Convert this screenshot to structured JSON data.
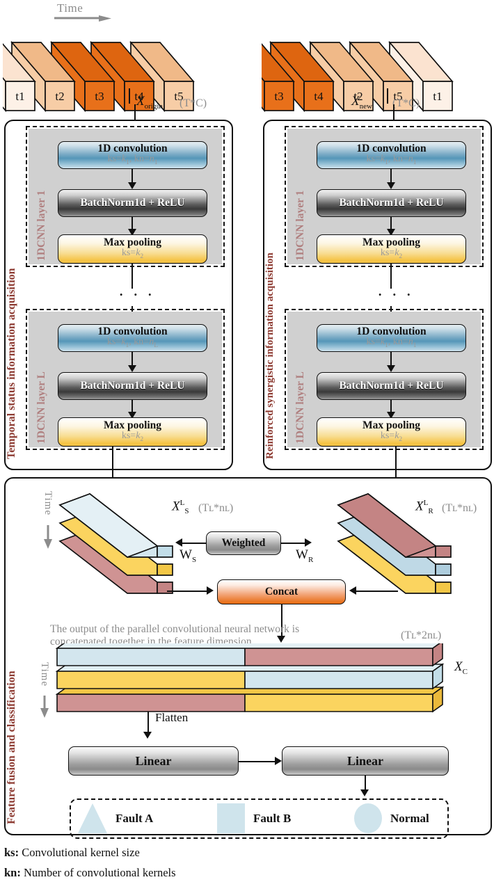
{
  "figure": {
    "time_label": "Time",
    "time_icon": "arrow-right-icon"
  },
  "input_left": {
    "steps": [
      "t1",
      "t2",
      "t3",
      "t4",
      "t5"
    ],
    "colors": [
      "#fdf1e7",
      "#f7cda6",
      "#e8701a",
      "#e8701a",
      "#f7cda6"
    ],
    "top_colors": [
      "#fbe3d0",
      "#f0b988",
      "#de6510",
      "#de6510",
      "#f0b988"
    ],
    "var_name": "X",
    "var_sub": "origin",
    "dim": "(T*C)"
  },
  "input_right": {
    "steps": [
      "t3",
      "t4",
      "t2",
      "t5",
      "t1"
    ],
    "colors": [
      "#e8701a",
      "#e8701a",
      "#f7cda6",
      "#f7cda6",
      "#fdf1e7"
    ],
    "top_colors": [
      "#de6510",
      "#de6510",
      "#f0b988",
      "#f0b988",
      "#fbe3d0"
    ],
    "var_name": "X",
    "var_sub": "new",
    "dim": "(T*C)"
  },
  "branch_left": {
    "panel_label": "Temporal status information acquisition",
    "layer1_label": "1DCNN layer 1",
    "layerL_label": "1DCNN layer L",
    "ellipsis": "· · ·"
  },
  "branch_right": {
    "panel_label": "Reinforced synergistic information acquisition",
    "layer1_label": "1DCNN layer 1",
    "layerL_label": "1DCNN layer L",
    "ellipsis": "· · ·"
  },
  "ops": {
    "conv_title": "1D convolution",
    "conv_params_layer1": "ks=k₁, kn=n₁",
    "conv_params_layerL": "ks=k₁, kn=n)",
    "bn_title": "BatchNorm1d + ReLU",
    "pool_title": "Max pooling",
    "pool_params": "ks=k₂"
  },
  "fusion": {
    "panel_label": "Feature fusion and classification",
    "time_label": "Time",
    "left_block": {
      "var": "X",
      "sup": "L",
      "sub": "S",
      "dim": "(Tʟ*nʟ)"
    },
    "right_block": {
      "var": "X",
      "sup": "L",
      "sub": "R",
      "dim": "(Tʟ*nʟ)"
    },
    "weighted_label": "Weighted",
    "w_left": "W",
    "w_left_sub": "S",
    "w_right": "W",
    "w_right_sub": "R",
    "concat_label": "Concat",
    "description": "The output of the parallel  convolutional neural network is concatenated together in the feature dimension",
    "concat_dim": "(Tʟ*2nʟ)",
    "concat_var": "X",
    "concat_var_sub": "C",
    "flatten_label": "Flatten",
    "linear1_label": "Linear",
    "linear2_label": "Linear",
    "slab_colors": {
      "blue": "#d3e6ee",
      "blue_top": "#c2dde8",
      "yellow": "#fbd45f",
      "yellow_top": "#f3c746",
      "rose": "#cf9393",
      "rose_top": "#c48484"
    }
  },
  "legend": {
    "items": [
      {
        "shape": "triangle-icon",
        "label": "Fault A"
      },
      {
        "shape": "square-icon",
        "label": "Fault B"
      },
      {
        "shape": "circle-icon",
        "label": "Normal"
      }
    ],
    "color": "#cfe4ec"
  },
  "footnotes": [
    {
      "key": "ks:",
      "text": " Convolutional kernel size"
    },
    {
      "key": "kn:",
      "text": " Number of convolutional kernels"
    }
  ],
  "colors": {
    "accent_orange": "#e8701a",
    "maroon": "#8d3b32",
    "layer_label": "#b08080",
    "grey_text": "#8c8c8c",
    "conv_blue": "#5596b8",
    "pool_amber": "#f5c242"
  }
}
